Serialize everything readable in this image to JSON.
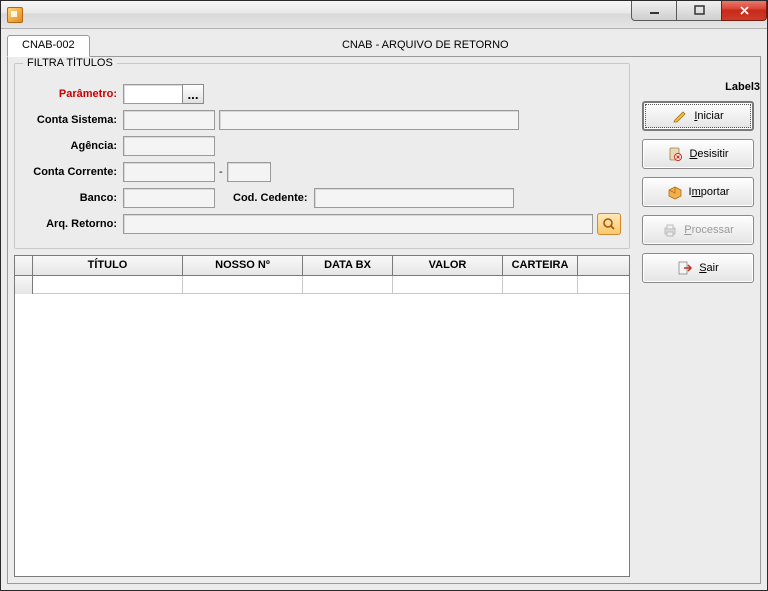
{
  "window": {
    "title": ""
  },
  "tab": {
    "code": "CNAB-002",
    "title": "CNAB - ARQUIVO DE RETORNO",
    "label3": "Label3"
  },
  "filter": {
    "group_title": "FILTRA TÍTULOS",
    "parametro_label": "Parâmetro:",
    "conta_sistema_label": "Conta Sistema:",
    "agencia_label": "Agência:",
    "conta_corrente_label": "Conta Corrente:",
    "banco_label": "Banco:",
    "cod_cedente_label": "Cod. Cedente:",
    "arq_retorno_label": "Arq. Retorno:",
    "lookup_btn": "...",
    "dash": "-",
    "values": {
      "parametro": "",
      "conta_sistema_code": "",
      "conta_sistema_desc": "",
      "agencia": "",
      "conta_corrente": "",
      "conta_corrente_dv": "",
      "banco": "",
      "cod_cedente": "",
      "arq_retorno": ""
    }
  },
  "actions": {
    "iniciar_pre": "",
    "iniciar_u": "I",
    "iniciar_post": "niciar",
    "desistir_pre": "",
    "desistir_u": "D",
    "desistir_post": "esisitir",
    "importar_pre": "I",
    "importar_u": "m",
    "importar_post": "portar",
    "processar_pre": "",
    "processar_u": "P",
    "processar_post": "rocessar",
    "sair_pre": "",
    "sair_u": "S",
    "sair_post": "air"
  },
  "grid": {
    "columns": {
      "titulo": "TÍTULO",
      "nosso_no": "NOSSO Nº",
      "data_bx": "DATA BX",
      "valor": "VALOR",
      "carteira": "CARTEIRA"
    },
    "col_widths": {
      "titulo": 150,
      "nosso_no": 120,
      "data_bx": 90,
      "valor": 110,
      "carteira": 75
    },
    "rows": [
      {
        "titulo": "",
        "nosso_no": "",
        "data_bx": "",
        "valor": "",
        "carteira": ""
      }
    ]
  }
}
